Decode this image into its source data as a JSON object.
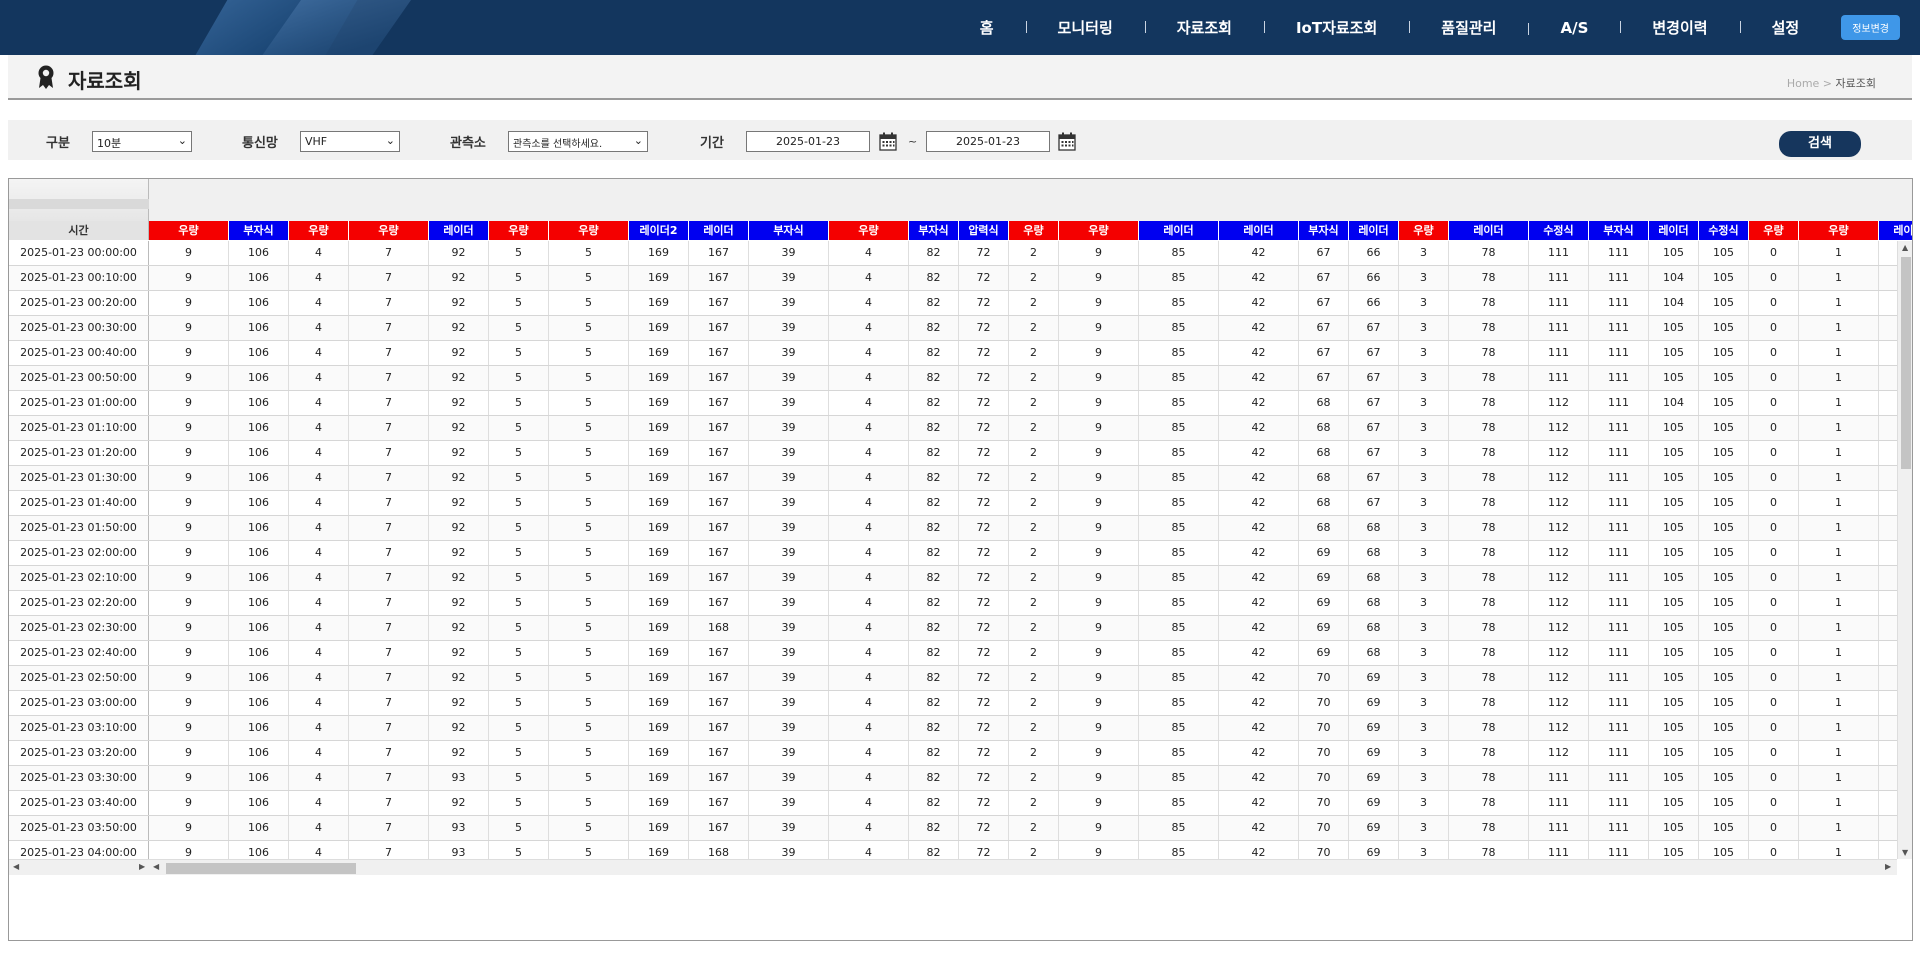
{
  "nav": {
    "items": [
      "홈",
      "모니터링",
      "자료조회",
      "IoT자료조회",
      "품질관리",
      "A/S",
      "변경이력",
      "설정"
    ],
    "button_label": "정보변경"
  },
  "page": {
    "title": "자료조회",
    "breadcrumb_home": "Home",
    "breadcrumb_sep": " > ",
    "breadcrumb_current": "자료조회"
  },
  "filter": {
    "type_label": "구분",
    "type_value": "10분",
    "network_label": "통신망",
    "network_value": "VHF",
    "station_label": "관측소",
    "station_value": "관측소를 선택하세요.",
    "period_label": "기간",
    "date_from": "2025-01-23",
    "date_sep": "~",
    "date_to": "2025-01-23",
    "search_label": "검색"
  },
  "table": {
    "time_header": "시간",
    "columns": [
      {
        "label": "우량",
        "color": "red"
      },
      {
        "label": "부자식",
        "color": "blue"
      },
      {
        "label": "우량",
        "color": "red"
      },
      {
        "label": "우량",
        "color": "red"
      },
      {
        "label": "레이더",
        "color": "blue"
      },
      {
        "label": "우량",
        "color": "red"
      },
      {
        "label": "우량",
        "color": "red"
      },
      {
        "label": "레이더2",
        "color": "blue"
      },
      {
        "label": "레이더",
        "color": "blue"
      },
      {
        "label": "부자식",
        "color": "blue"
      },
      {
        "label": "우량",
        "color": "red"
      },
      {
        "label": "부자식",
        "color": "blue"
      },
      {
        "label": "압력식",
        "color": "blue"
      },
      {
        "label": "우량",
        "color": "red"
      },
      {
        "label": "우량",
        "color": "red"
      },
      {
        "label": "레이더",
        "color": "blue"
      },
      {
        "label": "레이더",
        "color": "blue"
      },
      {
        "label": "부자식",
        "color": "blue"
      },
      {
        "label": "레이더",
        "color": "blue"
      },
      {
        "label": "우량",
        "color": "red"
      },
      {
        "label": "레이더",
        "color": "blue"
      },
      {
        "label": "수정식",
        "color": "blue"
      },
      {
        "label": "부자식",
        "color": "blue"
      },
      {
        "label": "레이더",
        "color": "blue"
      },
      {
        "label": "수정식",
        "color": "blue"
      },
      {
        "label": "우량",
        "color": "red"
      },
      {
        "label": "우량",
        "color": "red"
      },
      {
        "label": "레이더",
        "color": "blue"
      }
    ],
    "rows": [
      {
        "time": "2025-01-23 00:00:00",
        "values": [
          "9",
          "106",
          "4",
          "7",
          "92",
          "5",
          "5",
          "169",
          "167",
          "39",
          "4",
          "82",
          "72",
          "2",
          "9",
          "85",
          "42",
          "67",
          "66",
          "3",
          "78",
          "111",
          "111",
          "105",
          "105",
          "0",
          "1",
          ""
        ]
      },
      {
        "time": "2025-01-23 00:10:00",
        "values": [
          "9",
          "106",
          "4",
          "7",
          "92",
          "5",
          "5",
          "169",
          "167",
          "39",
          "4",
          "82",
          "72",
          "2",
          "9",
          "85",
          "42",
          "67",
          "66",
          "3",
          "78",
          "111",
          "111",
          "104",
          "105",
          "0",
          "1",
          ""
        ]
      },
      {
        "time": "2025-01-23 00:20:00",
        "values": [
          "9",
          "106",
          "4",
          "7",
          "92",
          "5",
          "5",
          "169",
          "167",
          "39",
          "4",
          "82",
          "72",
          "2",
          "9",
          "85",
          "42",
          "67",
          "66",
          "3",
          "78",
          "111",
          "111",
          "104",
          "105",
          "0",
          "1",
          ""
        ]
      },
      {
        "time": "2025-01-23 00:30:00",
        "values": [
          "9",
          "106",
          "4",
          "7",
          "92",
          "5",
          "5",
          "169",
          "167",
          "39",
          "4",
          "82",
          "72",
          "2",
          "9",
          "85",
          "42",
          "67",
          "67",
          "3",
          "78",
          "111",
          "111",
          "105",
          "105",
          "0",
          "1",
          ""
        ]
      },
      {
        "time": "2025-01-23 00:40:00",
        "values": [
          "9",
          "106",
          "4",
          "7",
          "92",
          "5",
          "5",
          "169",
          "167",
          "39",
          "4",
          "82",
          "72",
          "2",
          "9",
          "85",
          "42",
          "67",
          "67",
          "3",
          "78",
          "111",
          "111",
          "105",
          "105",
          "0",
          "1",
          ""
        ]
      },
      {
        "time": "2025-01-23 00:50:00",
        "values": [
          "9",
          "106",
          "4",
          "7",
          "92",
          "5",
          "5",
          "169",
          "167",
          "39",
          "4",
          "82",
          "72",
          "2",
          "9",
          "85",
          "42",
          "67",
          "67",
          "3",
          "78",
          "111",
          "111",
          "105",
          "105",
          "0",
          "1",
          ""
        ]
      },
      {
        "time": "2025-01-23 01:00:00",
        "values": [
          "9",
          "106",
          "4",
          "7",
          "92",
          "5",
          "5",
          "169",
          "167",
          "39",
          "4",
          "82",
          "72",
          "2",
          "9",
          "85",
          "42",
          "68",
          "67",
          "3",
          "78",
          "112",
          "111",
          "104",
          "105",
          "0",
          "1",
          ""
        ]
      },
      {
        "time": "2025-01-23 01:10:00",
        "values": [
          "9",
          "106",
          "4",
          "7",
          "92",
          "5",
          "5",
          "169",
          "167",
          "39",
          "4",
          "82",
          "72",
          "2",
          "9",
          "85",
          "42",
          "68",
          "67",
          "3",
          "78",
          "112",
          "111",
          "105",
          "105",
          "0",
          "1",
          ""
        ]
      },
      {
        "time": "2025-01-23 01:20:00",
        "values": [
          "9",
          "106",
          "4",
          "7",
          "92",
          "5",
          "5",
          "169",
          "167",
          "39",
          "4",
          "82",
          "72",
          "2",
          "9",
          "85",
          "42",
          "68",
          "67",
          "3",
          "78",
          "112",
          "111",
          "105",
          "105",
          "0",
          "1",
          ""
        ]
      },
      {
        "time": "2025-01-23 01:30:00",
        "values": [
          "9",
          "106",
          "4",
          "7",
          "92",
          "5",
          "5",
          "169",
          "167",
          "39",
          "4",
          "82",
          "72",
          "2",
          "9",
          "85",
          "42",
          "68",
          "67",
          "3",
          "78",
          "112",
          "111",
          "105",
          "105",
          "0",
          "1",
          ""
        ]
      },
      {
        "time": "2025-01-23 01:40:00",
        "values": [
          "9",
          "106",
          "4",
          "7",
          "92",
          "5",
          "5",
          "169",
          "167",
          "39",
          "4",
          "82",
          "72",
          "2",
          "9",
          "85",
          "42",
          "68",
          "67",
          "3",
          "78",
          "112",
          "111",
          "105",
          "105",
          "0",
          "1",
          ""
        ]
      },
      {
        "time": "2025-01-23 01:50:00",
        "values": [
          "9",
          "106",
          "4",
          "7",
          "92",
          "5",
          "5",
          "169",
          "167",
          "39",
          "4",
          "82",
          "72",
          "2",
          "9",
          "85",
          "42",
          "68",
          "68",
          "3",
          "78",
          "112",
          "111",
          "105",
          "105",
          "0",
          "1",
          ""
        ]
      },
      {
        "time": "2025-01-23 02:00:00",
        "values": [
          "9",
          "106",
          "4",
          "7",
          "92",
          "5",
          "5",
          "169",
          "167",
          "39",
          "4",
          "82",
          "72",
          "2",
          "9",
          "85",
          "42",
          "69",
          "68",
          "3",
          "78",
          "112",
          "111",
          "105",
          "105",
          "0",
          "1",
          ""
        ]
      },
      {
        "time": "2025-01-23 02:10:00",
        "values": [
          "9",
          "106",
          "4",
          "7",
          "92",
          "5",
          "5",
          "169",
          "167",
          "39",
          "4",
          "82",
          "72",
          "2",
          "9",
          "85",
          "42",
          "69",
          "68",
          "3",
          "78",
          "112",
          "111",
          "105",
          "105",
          "0",
          "1",
          ""
        ]
      },
      {
        "time": "2025-01-23 02:20:00",
        "values": [
          "9",
          "106",
          "4",
          "7",
          "92",
          "5",
          "5",
          "169",
          "167",
          "39",
          "4",
          "82",
          "72",
          "2",
          "9",
          "85",
          "42",
          "69",
          "68",
          "3",
          "78",
          "112",
          "111",
          "105",
          "105",
          "0",
          "1",
          ""
        ]
      },
      {
        "time": "2025-01-23 02:30:00",
        "values": [
          "9",
          "106",
          "4",
          "7",
          "92",
          "5",
          "5",
          "169",
          "168",
          "39",
          "4",
          "82",
          "72",
          "2",
          "9",
          "85",
          "42",
          "69",
          "68",
          "3",
          "78",
          "112",
          "111",
          "105",
          "105",
          "0",
          "1",
          ""
        ]
      },
      {
        "time": "2025-01-23 02:40:00",
        "values": [
          "9",
          "106",
          "4",
          "7",
          "92",
          "5",
          "5",
          "169",
          "167",
          "39",
          "4",
          "82",
          "72",
          "2",
          "9",
          "85",
          "42",
          "69",
          "68",
          "3",
          "78",
          "112",
          "111",
          "105",
          "105",
          "0",
          "1",
          ""
        ]
      },
      {
        "time": "2025-01-23 02:50:00",
        "values": [
          "9",
          "106",
          "4",
          "7",
          "92",
          "5",
          "5",
          "169",
          "167",
          "39",
          "4",
          "82",
          "72",
          "2",
          "9",
          "85",
          "42",
          "70",
          "69",
          "3",
          "78",
          "112",
          "111",
          "105",
          "105",
          "0",
          "1",
          ""
        ]
      },
      {
        "time": "2025-01-23 03:00:00",
        "values": [
          "9",
          "106",
          "4",
          "7",
          "92",
          "5",
          "5",
          "169",
          "167",
          "39",
          "4",
          "82",
          "72",
          "2",
          "9",
          "85",
          "42",
          "70",
          "69",
          "3",
          "78",
          "112",
          "111",
          "105",
          "105",
          "0",
          "1",
          ""
        ]
      },
      {
        "time": "2025-01-23 03:10:00",
        "values": [
          "9",
          "106",
          "4",
          "7",
          "92",
          "5",
          "5",
          "169",
          "167",
          "39",
          "4",
          "82",
          "72",
          "2",
          "9",
          "85",
          "42",
          "70",
          "69",
          "3",
          "78",
          "112",
          "111",
          "105",
          "105",
          "0",
          "1",
          ""
        ]
      },
      {
        "time": "2025-01-23 03:20:00",
        "values": [
          "9",
          "106",
          "4",
          "7",
          "92",
          "5",
          "5",
          "169",
          "167",
          "39",
          "4",
          "82",
          "72",
          "2",
          "9",
          "85",
          "42",
          "70",
          "69",
          "3",
          "78",
          "112",
          "111",
          "105",
          "105",
          "0",
          "1",
          ""
        ]
      },
      {
        "time": "2025-01-23 03:30:00",
        "values": [
          "9",
          "106",
          "4",
          "7",
          "93",
          "5",
          "5",
          "169",
          "167",
          "39",
          "4",
          "82",
          "72",
          "2",
          "9",
          "85",
          "42",
          "70",
          "69",
          "3",
          "78",
          "111",
          "111",
          "105",
          "105",
          "0",
          "1",
          ""
        ]
      },
      {
        "time": "2025-01-23 03:40:00",
        "values": [
          "9",
          "106",
          "4",
          "7",
          "92",
          "5",
          "5",
          "169",
          "167",
          "39",
          "4",
          "82",
          "72",
          "2",
          "9",
          "85",
          "42",
          "70",
          "69",
          "3",
          "78",
          "111",
          "111",
          "105",
          "105",
          "0",
          "1",
          ""
        ]
      },
      {
        "time": "2025-01-23 03:50:00",
        "values": [
          "9",
          "106",
          "4",
          "7",
          "93",
          "5",
          "5",
          "169",
          "167",
          "39",
          "4",
          "82",
          "72",
          "2",
          "9",
          "85",
          "42",
          "70",
          "69",
          "3",
          "78",
          "111",
          "111",
          "105",
          "105",
          "0",
          "1",
          ""
        ]
      },
      {
        "time": "2025-01-23 04:00:00",
        "values": [
          "9",
          "106",
          "4",
          "7",
          "93",
          "5",
          "5",
          "169",
          "168",
          "39",
          "4",
          "82",
          "72",
          "2",
          "9",
          "85",
          "42",
          "70",
          "69",
          "3",
          "78",
          "111",
          "111",
          "105",
          "105",
          "0",
          "1",
          ""
        ]
      }
    ]
  },
  "colors": {
    "nav_bg": "#13365e",
    "header_red": "#f40000",
    "header_blue": "#0000f0",
    "search_button": "#16365d",
    "nav_button": "#3f97e8"
  },
  "icons": {
    "page_title_icon": "location-pin-icon",
    "calendar_icon": "calendar-icon"
  }
}
